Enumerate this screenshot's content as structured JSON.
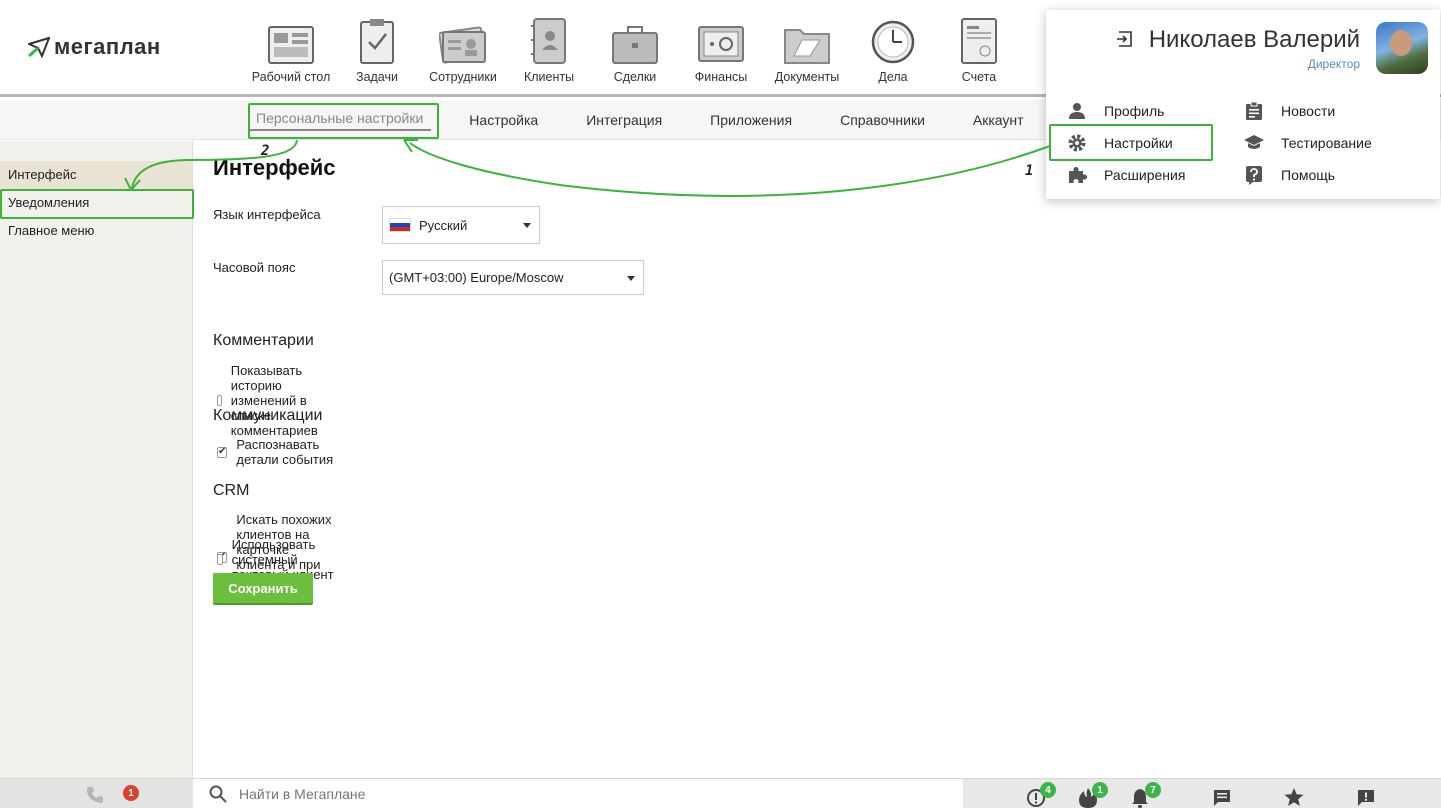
{
  "logo": {
    "text": "мегаплан"
  },
  "modules": [
    {
      "label": "Рабочий стол",
      "icon": "desktop-icon"
    },
    {
      "label": "Задачи",
      "icon": "tasks-icon"
    },
    {
      "label": "Сотрудники",
      "icon": "employees-icon"
    },
    {
      "label": "Клиенты",
      "icon": "clients-icon"
    },
    {
      "label": "Сделки",
      "icon": "deals-icon"
    },
    {
      "label": "Финансы",
      "icon": "finance-icon"
    },
    {
      "label": "Документы",
      "icon": "documents-icon"
    },
    {
      "label": "Дела",
      "icon": "affairs-icon"
    },
    {
      "label": "Счета",
      "icon": "invoices-icon"
    }
  ],
  "subnav": [
    {
      "label": "Персональные настройки",
      "active": true
    },
    {
      "label": "Настройка"
    },
    {
      "label": "Интеграция"
    },
    {
      "label": "Приложения"
    },
    {
      "label": "Справочники"
    },
    {
      "label": "Аккаунт"
    }
  ],
  "sidebar": [
    {
      "label": "Интерфейс",
      "active": true
    },
    {
      "label": "Уведомления"
    },
    {
      "label": "Главное меню"
    }
  ],
  "main": {
    "title": "Интерфейс",
    "language_label": "Язык интерфейса",
    "language_value": "Русский",
    "timezone_label": "Часовой пояс",
    "timezone_value": "(GMT+03:00) Europe/Moscow",
    "comments_heading": "Комментарии",
    "comments_opt": "Показывать историю изменений в списке комментариев",
    "comm_heading": "Коммуникации",
    "comm_opt": "Распознавать детали события",
    "crm_heading": "CRM",
    "crm_opt1": "Искать похожих клиентов на карточке клиента и при создании клиента",
    "crm_opt2": "Использовать системный почтовый клиент",
    "save": "Сохранить",
    "checks": {
      "comments": false,
      "comm": true,
      "crm1": true,
      "crm2": false
    }
  },
  "user_panel": {
    "name": "Николаев Валерий",
    "role": "Директор",
    "menu_left": [
      "Профиль",
      "Настройки",
      "Расширения"
    ],
    "menu_right": [
      "Новости",
      "Тестирование",
      "Помощь"
    ]
  },
  "annotations": {
    "n1": "1",
    "n2": "2"
  },
  "bottom": {
    "search_placeholder": "Найти в Мегаплане",
    "phone_badge": "1",
    "alerts_badge": "4",
    "hot_badge": "1",
    "bell_badge": "7"
  },
  "colors": {
    "accent_green": "#6cbf3c",
    "highlight": "#3ab53a",
    "badge_red": "#d9442e"
  }
}
